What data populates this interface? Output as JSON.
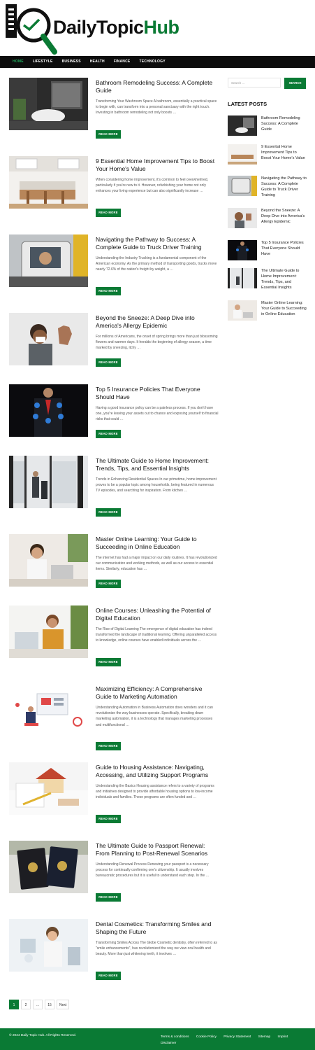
{
  "site": {
    "logo_text_main": "DailyTopic",
    "logo_text_accent": "Hub"
  },
  "nav": {
    "items": [
      {
        "label": "HOME",
        "active": true
      },
      {
        "label": "LIFESTYLE",
        "active": false
      },
      {
        "label": "BUSINESS",
        "active": false
      },
      {
        "label": "HEALTH",
        "active": false
      },
      {
        "label": "FINANCE",
        "active": false
      },
      {
        "label": "TECHNOLOGY",
        "active": false
      }
    ]
  },
  "posts": [
    {
      "title": "Bathroom Remodeling Success: A Complete Guide",
      "excerpt": "Transforming Your Washroom Space A bathroom, essentially a practical space to begin with, can transform into a personal sanctuary with the right touch. Investing in bathroom remodeling not only boosts …",
      "button": "READ MORE",
      "image": "bathroom-image"
    },
    {
      "title": "9 Essential Home Improvement Tips to Boost Your Home's Value",
      "excerpt": "When considering home improvement, it's common to feel overwhelmed, particularly if you're new to it. However, refurbishing your home not only enhances your living experience but can also significantly increase …",
      "button": "READ MORE",
      "image": "kitchen-image"
    },
    {
      "title": "Navigating the Pathway to Success: A Complete Guide to Truck Driver Training",
      "excerpt": "Understanding the Industry Trucking is a fundamental component of the American economy. As the primary method of transporting goods, trucks move nearly 72.6% of the nation's freight by weight, a …",
      "button": "READ MORE",
      "image": "truck-image"
    },
    {
      "title": "Beyond the Sneeze: A Deep Dive into America's Allergy Epidemic",
      "excerpt": "For millions of Americans, the onset of spring brings more than just blossoming flowers and warmer days. It heralds the beginning of allergy season, a time marked by sneezing, itchy …",
      "button": "READ MORE",
      "image": "sneeze-image"
    },
    {
      "title": "Top 5 Insurance Policies That Everyone Should Have",
      "excerpt": "Having a good insurance policy can be a painless process. If you don't have one, you're leaving your assets out to chance and exposing yourself to financial risks that could …",
      "button": "READ MORE",
      "image": "insurance-image"
    },
    {
      "title": "The Ultimate Guide to Home Improvement: Trends, Tips, and Essential Insights",
      "excerpt": "Trends in Enhancing Residential Spaces In our primetime, home improvement proves to be a popular topic among households, being featured in numerous TV episodes, and searching for inspiration. From kitchen …",
      "button": "READ MORE",
      "image": "renovation-image"
    },
    {
      "title": "Master Online Learning: Your Guide to Succeeding in Online Education",
      "excerpt": "The internet has had a major impact on our daily routines. It has revolutionized our communication and working methods, as well as our access to essential items. Similarly, education has …",
      "button": "READ MORE",
      "image": "online-learning-image"
    },
    {
      "title": "Online Courses: Unleashing the Potential of Digital Education",
      "excerpt": "The Rise of Digital Learning The emergence of digital education has indeed transformed the landscape of traditional learning. Offering unparalleled access to knowledge, online courses have enabled individuals across the …",
      "button": "READ MORE",
      "image": "online-course-image"
    },
    {
      "title": "Maximizing Efficiency: A Comprehensive Guide to Marketing Automation",
      "excerpt": "Understanding Automation in Business Automation does wonders and it can revolutionize the way businesses operate. Specifically, breaking down marketing automation, it is a technology that manages marketing processes and multifunctional …",
      "button": "READ MORE",
      "image": "automation-image"
    },
    {
      "title": "Guide to Housing Assistance: Navigating, Accessing, and Utilizing Support Programs",
      "excerpt": "Understanding the Basics Housing assistance refers to a variety of programs and initiatives designed to provide affordable housing options to low-income individuals and families. These programs are often funded and …",
      "button": "READ MORE",
      "image": "housing-image"
    },
    {
      "title": "The Ultimate Guide to Passport Renewal: From Planning to Post-Renewal Scenarios",
      "excerpt": "Understanding Renewal Process Renewing your passport is a necessary process for continually confirming one's citizenship. It usually involves bureaucratic procedures but it is useful to understand each step. In the …",
      "button": "READ MORE",
      "image": "passport-image"
    },
    {
      "title": "Dental Cosmetics: Transforming Smiles and Shaping the Future",
      "excerpt": "Transforming Smiles Across The Globe Cosmetic dentistry, often referred to as \"smile enhancements\", has revolutionized the way we view oral health and beauty. More than just whitening teeth, it involves …",
      "button": "READ MORE",
      "image": "dental-image"
    }
  ],
  "sidebar": {
    "search_placeholder": "Search …",
    "search_button": "SEARCH",
    "latest_heading": "LATEST POSTS",
    "latest": [
      {
        "title": "Bathroom Remodeling Success: A Complete Guide"
      },
      {
        "title": "9 Essential Home Improvement Tips to Boost Your Home's Value"
      },
      {
        "title": "Navigating the Pathway to Success: A Complete Guide to Truck Driver Training"
      },
      {
        "title": "Beyond the Sneeze: A Deep Dive into America's Allergy Epidemic"
      },
      {
        "title": "Top 5 Insurance Policies That Everyone Should Have"
      },
      {
        "title": "The Ultimate Guide to Home Improvement: Trends, Tips, and Essential Insights"
      },
      {
        "title": "Master Online Learning: Your Guide to Succeeding in Online Education"
      }
    ]
  },
  "pagination": {
    "pages": [
      "1",
      "2",
      "…",
      "15",
      "Next"
    ],
    "current": "1"
  },
  "footer": {
    "copyright": "© 2024 Daily Topic Hub. All Rights Reserved.",
    "links": [
      "Terms & conditions",
      "Cookie Policy",
      "Privacy Statement",
      "Sitemap",
      "Imprint",
      "Disclaimer"
    ]
  },
  "colors": {
    "accent": "#0a7a34",
    "nav_bg": "#0d0d0d",
    "nav_active": "#1ea85a"
  }
}
